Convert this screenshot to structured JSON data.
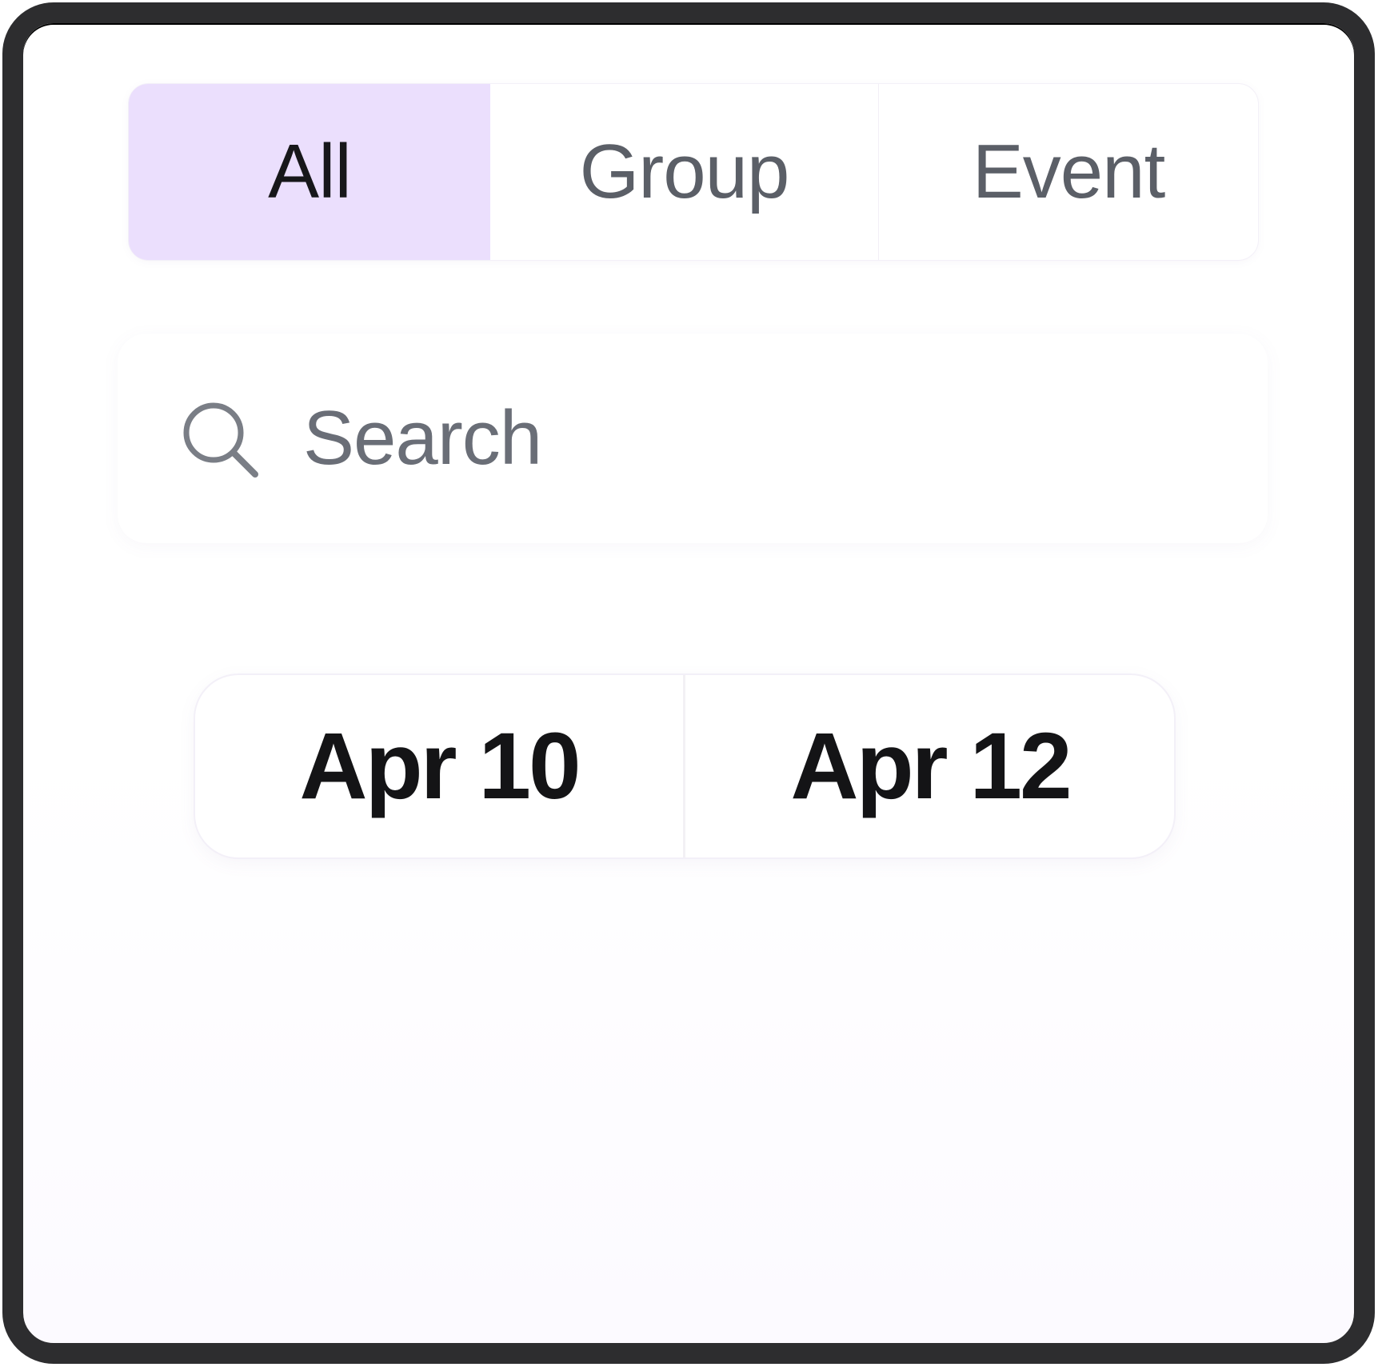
{
  "tabs": [
    {
      "label": "All",
      "active": true
    },
    {
      "label": "Group",
      "active": false
    },
    {
      "label": "Event",
      "active": false
    }
  ],
  "search": {
    "placeholder": "Search",
    "icon": "search-icon"
  },
  "date_range": {
    "start": "Apr 10",
    "end": "Apr 12"
  },
  "colors": {
    "active_tab_bg": "#ebdffd",
    "frame": "#2d2d2f",
    "text_primary": "#141416",
    "text_muted": "#5b5f67"
  }
}
